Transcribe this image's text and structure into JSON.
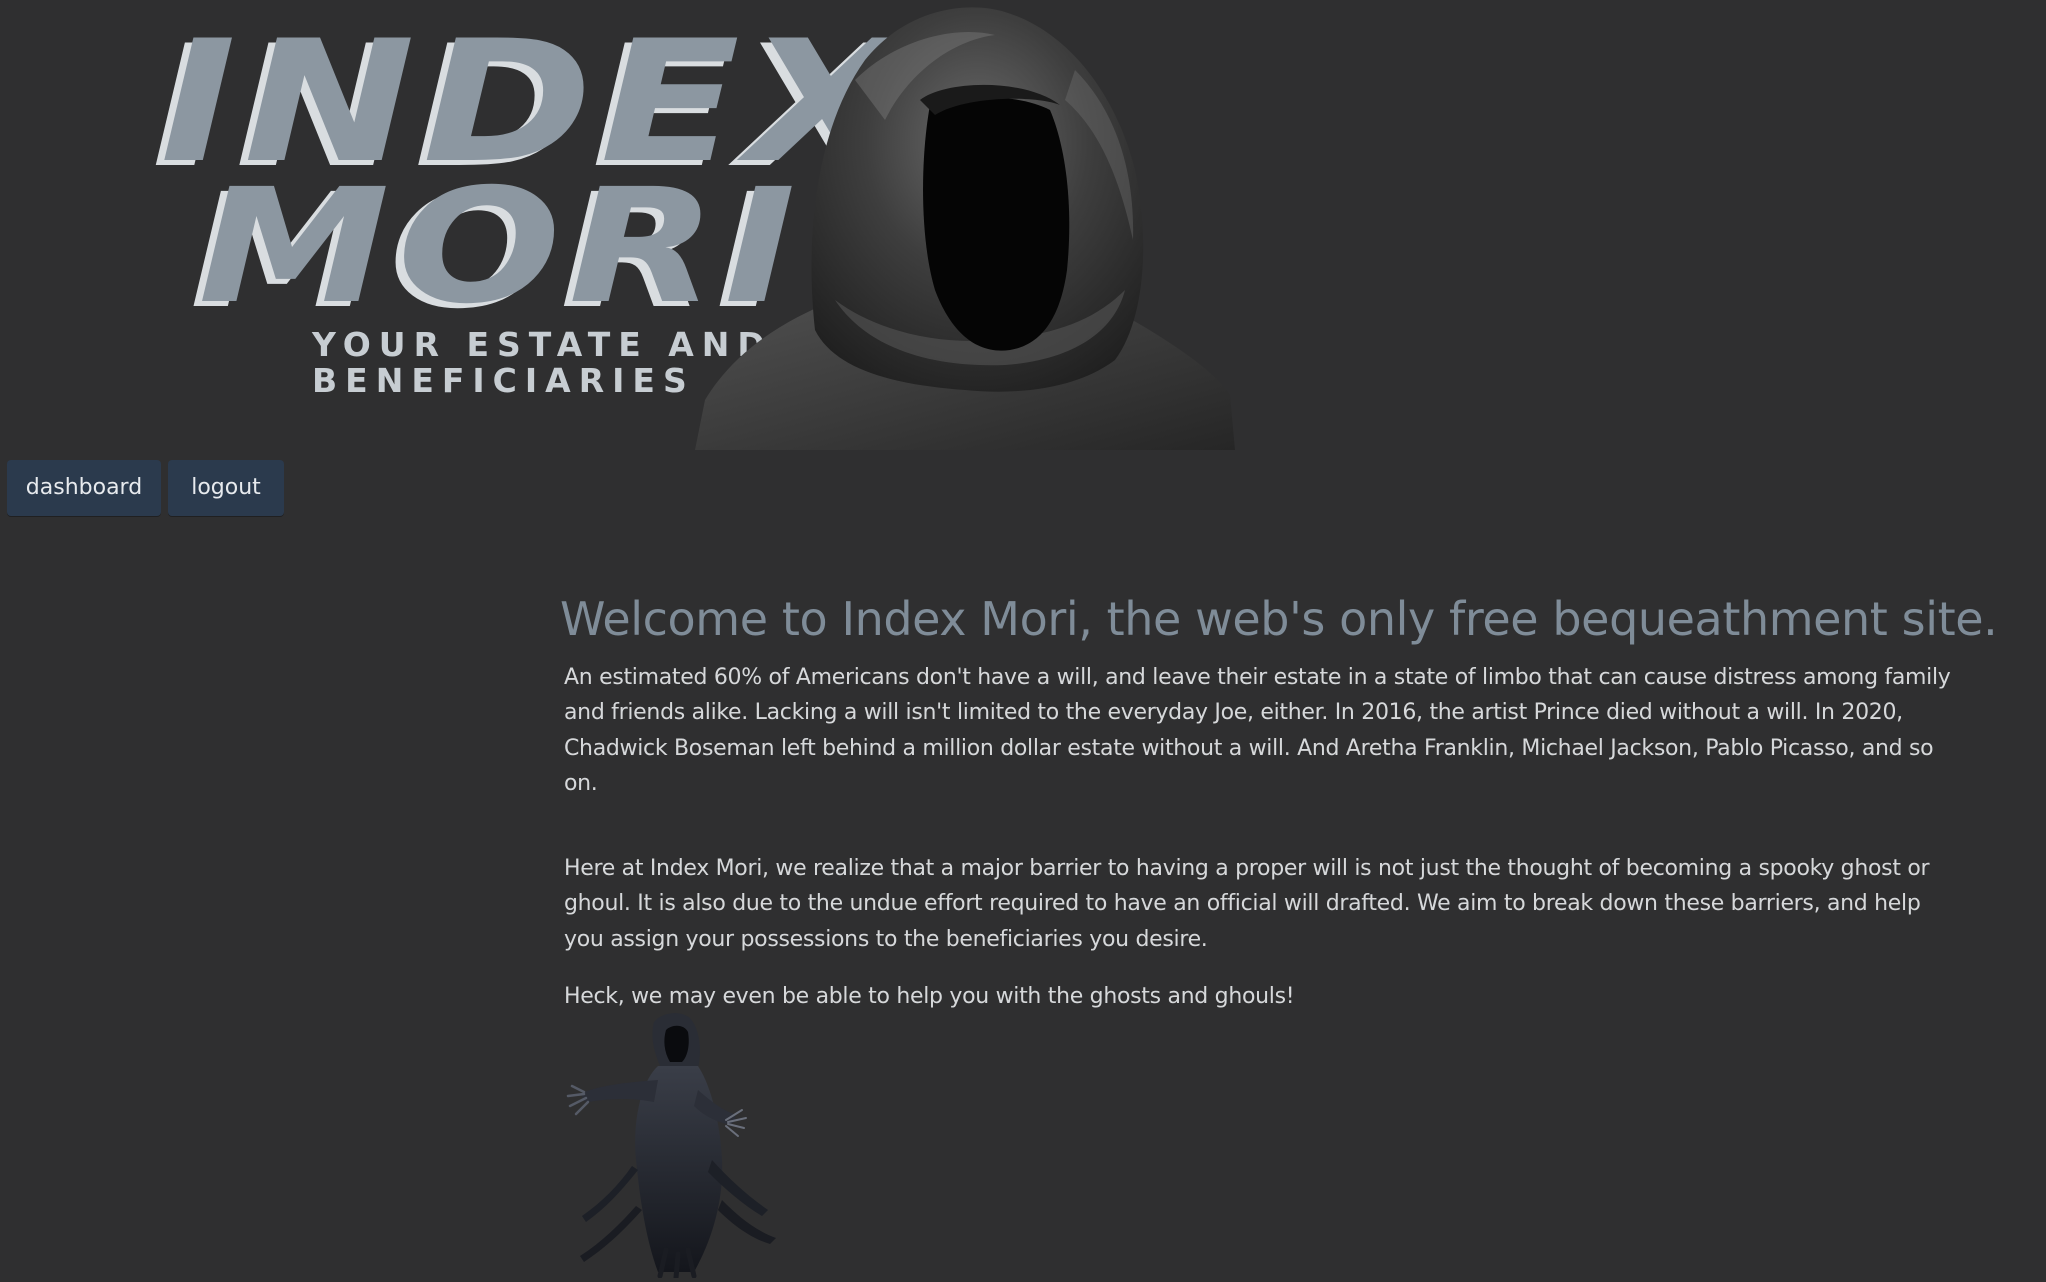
{
  "header": {
    "logo_line1": "INDEX",
    "logo_line2": "MORI",
    "tagline_line1": "YOUR ESTATE AND",
    "tagline_line2": "BENEFICIARIES"
  },
  "nav": {
    "dashboard_label": "dashboard",
    "logout_label": "logout"
  },
  "main": {
    "title": "Welcome to Index Mori, the web's only free bequeathment site.",
    "paragraphs": [
      "An estimated 60% of Americans don't have a will, and leave their estate in a state of limbo that can cause distress among family and friends alike. Lacking a will isn't limited to the everyday Joe, either. In 2016, the artist Prince died without a will. In 2020, Chadwick Boseman left behind a million dollar estate without a will. And Aretha Franklin, Michael Jackson, Pablo Picasso, and so on.",
      "Here at Index Mori, we realize that a major barrier to having a proper will is not just the thought of becoming a spooky ghost or ghoul. It is also due to the undue effort required to have an official will drafted. We aim to break down these barriers, and help you assign your possessions to the beneficiaries you desire.",
      "Heck, we may even be able to help you with the ghosts and ghouls!"
    ]
  },
  "colors": {
    "background": "#2f2f30",
    "button_bg": "#2b3a4d",
    "title": "#7f8c98",
    "body_text": "#d6d8da",
    "logo": "#8c97a1"
  },
  "icons": {
    "header_image": "hooded-reaper-image",
    "footer_image": "dementor-figure-image"
  }
}
